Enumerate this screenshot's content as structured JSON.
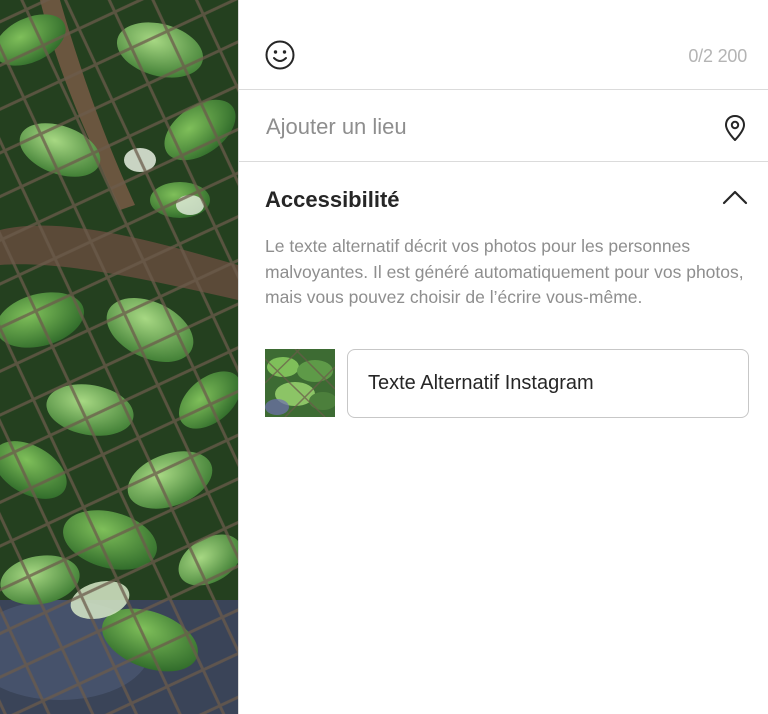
{
  "caption": {
    "emoji_icon": "smiley-face-icon",
    "char_count": "0/2 200"
  },
  "location": {
    "label": "Ajouter un lieu",
    "icon": "location-pin-icon"
  },
  "accessibility": {
    "title": "Accessibilité",
    "toggle_icon": "chevron-up-icon",
    "description": "Le texte alternatif décrit vos photos pour les personnes malvoyantes. Il est généré automatiquement pour vos photos, mais vous pouvez choisir de l’écrire vous-même.",
    "alt_text_value": "Texte Alternatif Instagram"
  },
  "colors": {
    "divider": "#dbdbdb",
    "muted_text": "#8e8e8e",
    "primary_text": "#262626",
    "counter_text": "#b4b4b4"
  }
}
